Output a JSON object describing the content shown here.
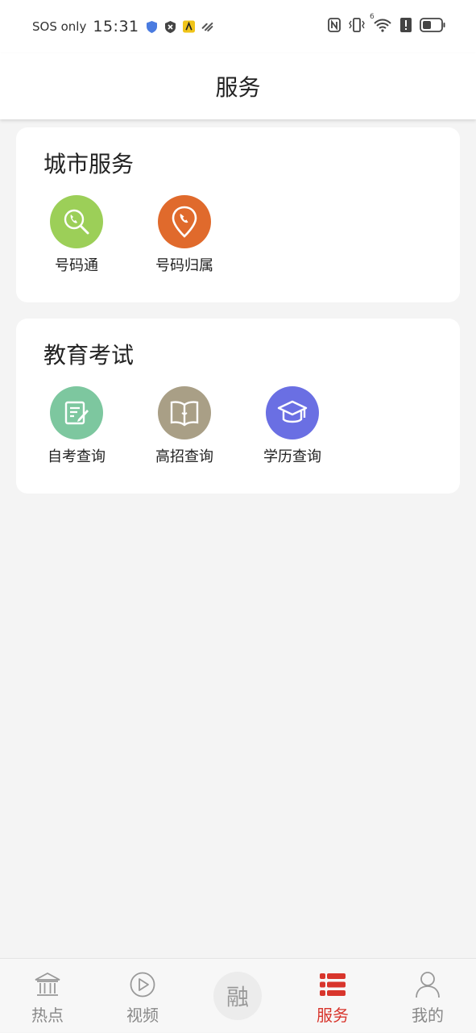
{
  "status_bar": {
    "sos": "SOS only",
    "time": "15:31",
    "signal_label": "6",
    "icons": [
      "shield-icon",
      "block-icon",
      "app-notification-icon",
      "link-icon",
      "nfc-icon",
      "vibrate-icon",
      "wifi-icon",
      "alert-icon",
      "battery-icon"
    ]
  },
  "header": {
    "title": "服务"
  },
  "sections": {
    "city": {
      "title": "城市服务",
      "items": [
        {
          "label": "号码通",
          "icon": "phone-search-icon",
          "color": "#9ccf58"
        },
        {
          "label": "号码归属",
          "icon": "phone-location-icon",
          "color": "#e06a2c"
        }
      ]
    },
    "education": {
      "title": "教育考试",
      "items": [
        {
          "label": "自考查询",
          "icon": "edit-note-icon",
          "color": "#7dc79f"
        },
        {
          "label": "高招查询",
          "icon": "open-book-icon",
          "color": "#a99f86"
        },
        {
          "label": "学历查询",
          "icon": "graduation-cap-icon",
          "color": "#6a6fe3"
        }
      ]
    }
  },
  "tabbar": {
    "items": [
      {
        "label": "热点",
        "icon": "building-icon",
        "active": false
      },
      {
        "label": "视频",
        "icon": "play-icon",
        "active": false
      },
      {
        "label": "融",
        "icon": "center-logo",
        "active": false
      },
      {
        "label": "服务",
        "icon": "list-icon",
        "active": true
      },
      {
        "label": "我的",
        "icon": "user-icon",
        "active": false
      }
    ],
    "active_color": "#d8352c",
    "inactive_color": "#888888"
  }
}
